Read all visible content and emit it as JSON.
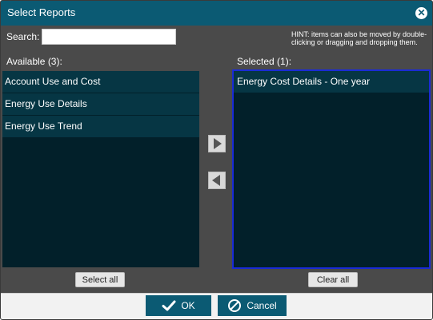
{
  "dialog": {
    "title": "Select Reports",
    "close_icon": "close-icon"
  },
  "search": {
    "label": "Search:",
    "value": "",
    "placeholder": ""
  },
  "hint": "HINT: items can also be moved by double-clicking or dragging and dropping them.",
  "available": {
    "label": "Available (3):",
    "items": [
      {
        "label": "Account Use and Cost"
      },
      {
        "label": "Energy Use Details"
      },
      {
        "label": "Energy Use Trend"
      }
    ],
    "select_all_label": "Select all"
  },
  "selected": {
    "label": "Selected (1):",
    "items": [
      {
        "label": "Energy Cost Details - One year"
      }
    ],
    "clear_all_label": "Clear all"
  },
  "transfer": {
    "add_icon": "arrow-right-icon",
    "remove_icon": "arrow-left-icon"
  },
  "footer": {
    "ok_label": "OK",
    "cancel_label": "Cancel",
    "ok_icon": "checkmark-icon",
    "cancel_icon": "cancel-icon"
  },
  "colors": {
    "titlebar": "#0b5a73",
    "dialog_bg": "#4a4a4a",
    "list_bg": "#02202a",
    "list_item_bg": "#063644",
    "selected_border": "#1a2bd6"
  }
}
